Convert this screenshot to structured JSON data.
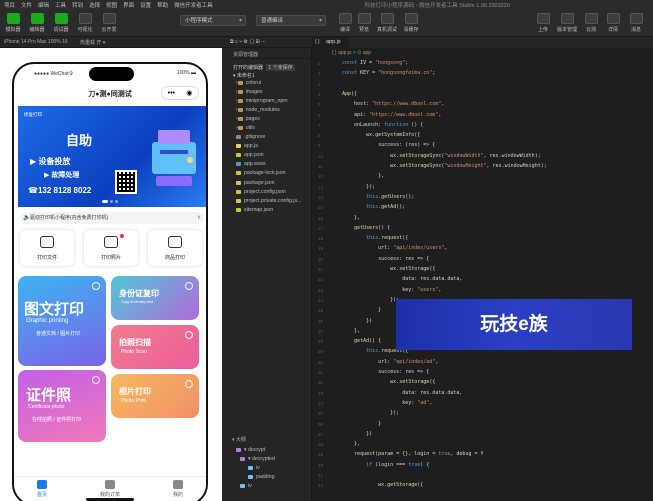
{
  "menubar": {
    "items": [
      "项目",
      "文件",
      "编辑",
      "工具",
      "转到",
      "选择",
      "视图",
      "界面",
      "设置",
      "帮助",
      "微信开发者工具"
    ],
    "window_title": "科技打印小程序源码 - 微信开发者工具 Stable 1.06.2303220"
  },
  "toolbar": {
    "left_buttons": [
      "模拟器",
      "编辑器",
      "调试器",
      "可视化",
      "云开发"
    ],
    "mode_select": "小程序模式",
    "compile_select": "普通编译",
    "center_buttons": [
      "编译",
      "预览",
      "真机调试",
      "清缓存"
    ],
    "right_buttons": [
      "上传",
      "版本管理",
      "云测",
      "详情",
      "消息"
    ]
  },
  "subbar": {
    "device": "iPhone 14 Pro Max 100% 16",
    "network": "热重载 开 ▾"
  },
  "phone": {
    "carrier": "●●●●● WeChat令",
    "battery": "100% ▬",
    "nav_title": "刀●测●同测试",
    "capsule_dots": "•••",
    "banner": {
      "tag": "修复打印",
      "headline": "自助",
      "line1": "▶ 设备投放",
      "line2": "▶ 故障处理",
      "phone": "132 8128 8022"
    },
    "notice": "驱动打印机小程序(内含免费打印机)",
    "quick": [
      {
        "label": "打印文件"
      },
      {
        "label": "打印照片"
      },
      {
        "label": "商品打印"
      }
    ],
    "cards": {
      "c1_title": "图文打印",
      "c1_en": "Graphic printing",
      "c1_sub": "普通文档 / 图片打印",
      "c2_title": "身份证复印",
      "c2_en": "Copy of identity card",
      "c3_title": "证件照",
      "c3_en": "Certificate photo",
      "c3_sub": "在线拍照 / 证件照打印",
      "c4_title": "拍照扫描",
      "c4_en": "Photo Scan",
      "c5_title": "相片打印",
      "c5_en": "Photo Print"
    },
    "tabs": [
      "首页",
      "我的订单",
      "我的"
    ]
  },
  "explorer": {
    "header": "资源管理器",
    "open_editors": "打开的编辑器",
    "open_count": "1 个未保存",
    "project": "▾ 未命名1",
    "tree": [
      {
        "name": "colorui",
        "type": "folder"
      },
      {
        "name": "images",
        "type": "folder"
      },
      {
        "name": "miniprogram_npm",
        "type": "folder"
      },
      {
        "name": "node_modules",
        "type": "folder"
      },
      {
        "name": "pages",
        "type": "folder"
      },
      {
        "name": "utils",
        "type": "folder"
      },
      {
        "name": ".gitignore",
        "type": "file"
      },
      {
        "name": "app.js",
        "type": "js"
      },
      {
        "name": "app.json",
        "type": "json"
      },
      {
        "name": "app.wxss",
        "type": "css"
      },
      {
        "name": "package-lock.json",
        "type": "json"
      },
      {
        "name": "package.json",
        "type": "json"
      },
      {
        "name": "project.config.json",
        "type": "json"
      },
      {
        "name": "project.private.config.js...",
        "type": "json"
      },
      {
        "name": "sitemap.json",
        "type": "json"
      }
    ],
    "outline_header": "▾ 大纲",
    "outline": [
      "▾ decrypt",
      "▾ decrypted",
      "iv",
      "padding",
      "iv"
    ]
  },
  "editor": {
    "tab": "app.js",
    "crumbs": "{ } app.js > ⊙ app",
    "lines": [
      "const IV = \"hongsong\";",
      "const KEY = \"hongsongfeima.cn\";",
      "",
      "App({",
      "    host: \"https://www.dbool.com\",",
      "    api: \"https://www.dbool.com\",",
      "    onLaunch: function () {",
      "        wx.getSystemInfo({",
      "            success: (res) => {",
      "                wx.setStorageSync(\"windowWidth\", res.windowWidth);",
      "                wx.setStorageSync(\"windowHeight\", res.windowHeight);",
      "            },",
      "        });",
      "        this.getUsers();",
      "        this.getAd();",
      "    },",
      "    getUsers() {",
      "        this.request({",
      "            url: \"api/index/users\",",
      "            success: res => {",
      "                wx.setStorage({",
      "                    data: res.data.data,",
      "                    key: \"users\",",
      "                });",
      "            }",
      "        })",
      "    },",
      "    getAd() {",
      "        this.request({",
      "            url: \"api/index/ad\",",
      "            success: res => {",
      "                wx.setStorage({",
      "                    data: res.data.data,",
      "                    key: \"ad\",",
      "                });",
      "            }",
      "        })",
      "    },",
      "    request(param = {}, login = true, debug = f",
      "        if (login === true) {",
      "",
      "            wx.getStorage({"
    ]
  },
  "watermark": "玩技e族",
  "colors": {
    "bg": "#1e1e1e",
    "panel": "#252526",
    "accent": "#1aad19",
    "keyword": "#569cd6",
    "string": "#ce9178",
    "banner": "#1d6be8",
    "watermark": "#2b3fc4"
  }
}
